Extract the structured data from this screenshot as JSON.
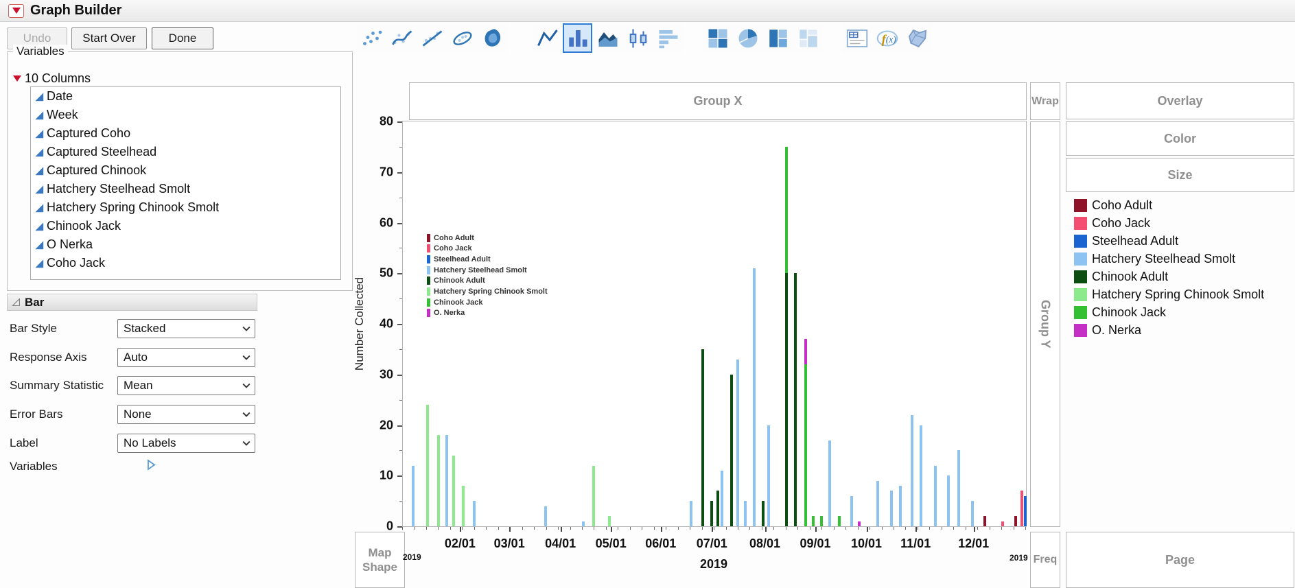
{
  "window": {
    "title": "Graph Builder"
  },
  "buttons": {
    "undo": "Undo",
    "start_over": "Start Over",
    "done": "Done"
  },
  "element_types": [
    {
      "name": "points",
      "selected": false,
      "group": 1
    },
    {
      "name": "smoother",
      "selected": false,
      "group": 1
    },
    {
      "name": "line-of-fit",
      "selected": false,
      "group": 1
    },
    {
      "name": "ellipse",
      "selected": false,
      "group": 1
    },
    {
      "name": "contour",
      "selected": false,
      "group": 1
    },
    {
      "name": "line",
      "selected": false,
      "group": 2
    },
    {
      "name": "bar",
      "selected": true,
      "group": 2
    },
    {
      "name": "area",
      "selected": false,
      "group": 2
    },
    {
      "name": "box-plot",
      "selected": false,
      "group": 2
    },
    {
      "name": "histogram",
      "selected": false,
      "group": 2
    },
    {
      "name": "heatmap",
      "selected": false,
      "group": 3
    },
    {
      "name": "pie",
      "selected": false,
      "group": 3
    },
    {
      "name": "treemap",
      "selected": false,
      "group": 3
    },
    {
      "name": "mosaic",
      "selected": false,
      "group": 3
    },
    {
      "name": "caption-box",
      "selected": false,
      "group": 4
    },
    {
      "name": "formula",
      "selected": false,
      "group": 4
    },
    {
      "name": "map-shapes",
      "selected": false,
      "group": 4
    }
  ],
  "variables_panel": {
    "title": "Variables",
    "columns_label": "10 Columns",
    "columns": [
      "Date",
      "Week",
      "Captured Coho",
      "Captured Steelhead",
      "Captured Chinook",
      "Hatchery Steelhead Smolt",
      "Hatchery Spring Chinook Smolt",
      "Chinook Jack",
      "O Nerka",
      "Coho Jack"
    ]
  },
  "bar_panel": {
    "title": "Bar",
    "rows": [
      {
        "name": "bar-style",
        "label": "Bar Style",
        "value": "Stacked"
      },
      {
        "name": "response-axis",
        "label": "Response Axis",
        "value": "Auto"
      },
      {
        "name": "summary-statistic",
        "label": "Summary Statistic",
        "value": "Mean"
      },
      {
        "name": "error-bars",
        "label": "Error Bars",
        "value": "None"
      },
      {
        "name": "label",
        "label": "Label",
        "value": "No Labels"
      }
    ],
    "variables_label": "Variables"
  },
  "zones": {
    "group_x": "Group X",
    "wrap": "Wrap",
    "overlay": "Overlay",
    "color": "Color",
    "size": "Size",
    "group_y": "Group Y",
    "map_shape": "Map Shape",
    "freq": "Freq",
    "page": "Page"
  },
  "chart_data": {
    "type": "bar",
    "stacked": true,
    "ylabel": "Number Collected",
    "ylim": [
      0,
      80
    ],
    "yticks": [
      0,
      10,
      20,
      30,
      40,
      50,
      60,
      70,
      80
    ],
    "grid": false,
    "legend_position": "right",
    "year_start": "2019",
    "year_center": "2019",
    "year_end": "2019",
    "x_axis_labels": [
      {
        "label": "02/01",
        "pos": 0.093
      },
      {
        "label": "03/01",
        "pos": 0.172
      },
      {
        "label": "04/01",
        "pos": 0.254
      },
      {
        "label": "05/01",
        "pos": 0.335
      },
      {
        "label": "06/01",
        "pos": 0.415
      },
      {
        "label": "07/01",
        "pos": 0.497
      },
      {
        "label": "08/01",
        "pos": 0.582
      },
      {
        "label": "09/01",
        "pos": 0.663
      },
      {
        "label": "10/01",
        "pos": 0.745
      },
      {
        "label": "11/01",
        "pos": 0.824
      },
      {
        "label": "12/01",
        "pos": 0.917
      }
    ],
    "series": [
      {
        "key": "coho_adult",
        "label": "Coho Adult",
        "color": "#8E1329"
      },
      {
        "key": "coho_jack",
        "label": "Coho Jack",
        "color": "#F44E72"
      },
      {
        "key": "steelhead_adult",
        "label": "Steelhead Adult",
        "color": "#1A64D2"
      },
      {
        "key": "hss",
        "label": "Hatchery Steelhead Smolt",
        "color": "#8DC3F2"
      },
      {
        "key": "chinook_adult",
        "label": "Chinook Adult",
        "color": "#0C4D12"
      },
      {
        "key": "hscs",
        "label": "Hatchery Spring Chinook Smolt",
        "color": "#8CE98C"
      },
      {
        "key": "chinook_jack",
        "label": "Chinook Jack",
        "color": "#33C033"
      },
      {
        "key": "o_nerka",
        "label": "O. Nerka",
        "color": "#C52FC5"
      }
    ],
    "bars": [
      {
        "pos": 0.017,
        "segments": [
          [
            "hss",
            12
          ]
        ]
      },
      {
        "pos": 0.04,
        "segments": [
          [
            "hscs",
            24
          ]
        ]
      },
      {
        "pos": 0.057,
        "segments": [
          [
            "hscs",
            18
          ]
        ]
      },
      {
        "pos": 0.07,
        "segments": [
          [
            "hss",
            18
          ]
        ]
      },
      {
        "pos": 0.082,
        "segments": [
          [
            "hscs",
            14
          ]
        ]
      },
      {
        "pos": 0.097,
        "segments": [
          [
            "hscs",
            8
          ]
        ]
      },
      {
        "pos": 0.114,
        "segments": [
          [
            "hss",
            5
          ]
        ]
      },
      {
        "pos": 0.229,
        "segments": [
          [
            "hss",
            4
          ]
        ]
      },
      {
        "pos": 0.29,
        "segments": [
          [
            "hss",
            1
          ]
        ]
      },
      {
        "pos": 0.306,
        "segments": [
          [
            "hscs",
            12
          ]
        ]
      },
      {
        "pos": 0.331,
        "segments": [
          [
            "hscs",
            2
          ]
        ]
      },
      {
        "pos": 0.463,
        "segments": [
          [
            "hss",
            5
          ]
        ]
      },
      {
        "pos": 0.481,
        "segments": [
          [
            "chinook_adult",
            35
          ]
        ]
      },
      {
        "pos": 0.496,
        "segments": [
          [
            "chinook_adult",
            5
          ]
        ]
      },
      {
        "pos": 0.505,
        "segments": [
          [
            "chinook_adult",
            7
          ]
        ]
      },
      {
        "pos": 0.512,
        "segments": [
          [
            "hss",
            11
          ]
        ]
      },
      {
        "pos": 0.528,
        "segments": [
          [
            "chinook_adult",
            30
          ]
        ]
      },
      {
        "pos": 0.537,
        "segments": [
          [
            "hss",
            33
          ]
        ]
      },
      {
        "pos": 0.55,
        "segments": [
          [
            "hss",
            5
          ]
        ]
      },
      {
        "pos": 0.564,
        "segments": [
          [
            "hss",
            51
          ]
        ]
      },
      {
        "pos": 0.578,
        "segments": [
          [
            "chinook_adult",
            5
          ]
        ]
      },
      {
        "pos": 0.587,
        "segments": [
          [
            "hss",
            20
          ]
        ]
      },
      {
        "pos": 0.616,
        "segments": [
          [
            "chinook_adult",
            50
          ],
          [
            "chinook_jack",
            25
          ]
        ]
      },
      {
        "pos": 0.63,
        "segments": [
          [
            "chinook_adult",
            50
          ]
        ]
      },
      {
        "pos": 0.646,
        "segments": [
          [
            "chinook_jack",
            32
          ],
          [
            "o_nerka",
            5
          ]
        ]
      },
      {
        "pos": 0.659,
        "segments": [
          [
            "chinook_jack",
            2
          ]
        ]
      },
      {
        "pos": 0.672,
        "segments": [
          [
            "chinook_jack",
            2
          ]
        ]
      },
      {
        "pos": 0.685,
        "segments": [
          [
            "hss",
            17
          ]
        ]
      },
      {
        "pos": 0.7,
        "segments": [
          [
            "chinook_jack",
            2
          ]
        ]
      },
      {
        "pos": 0.72,
        "segments": [
          [
            "hss",
            6
          ]
        ]
      },
      {
        "pos": 0.732,
        "segments": [
          [
            "o_nerka",
            1
          ]
        ]
      },
      {
        "pos": 0.762,
        "segments": [
          [
            "hss",
            9
          ]
        ]
      },
      {
        "pos": 0.784,
        "segments": [
          [
            "hss",
            7
          ]
        ]
      },
      {
        "pos": 0.799,
        "segments": [
          [
            "hss",
            8
          ]
        ]
      },
      {
        "pos": 0.817,
        "segments": [
          [
            "hss",
            22
          ]
        ]
      },
      {
        "pos": 0.832,
        "segments": [
          [
            "hss",
            20
          ]
        ]
      },
      {
        "pos": 0.855,
        "segments": [
          [
            "hss",
            12
          ]
        ]
      },
      {
        "pos": 0.876,
        "segments": [
          [
            "hss",
            10
          ]
        ]
      },
      {
        "pos": 0.892,
        "segments": [
          [
            "hss",
            15
          ]
        ]
      },
      {
        "pos": 0.914,
        "segments": [
          [
            "hss",
            5
          ]
        ]
      },
      {
        "pos": 0.934,
        "segments": [
          [
            "coho_adult",
            2
          ]
        ]
      },
      {
        "pos": 0.963,
        "segments": [
          [
            "coho_jack",
            1
          ]
        ]
      },
      {
        "pos": 0.983,
        "segments": [
          [
            "coho_adult",
            2
          ]
        ]
      },
      {
        "pos": 0.993,
        "segments": [
          [
            "coho_jack",
            7
          ]
        ]
      },
      {
        "pos": 0.999,
        "segments": [
          [
            "steelhead_adult",
            6
          ]
        ]
      }
    ]
  }
}
